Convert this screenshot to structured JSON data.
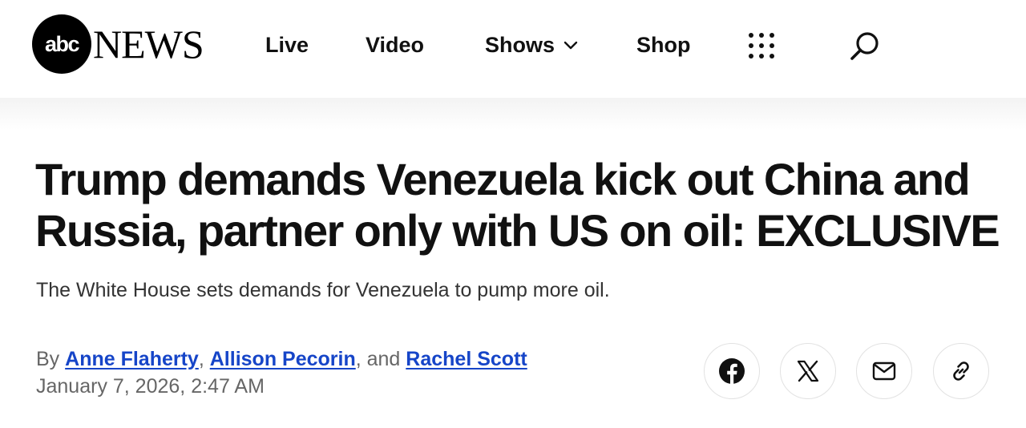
{
  "brand": {
    "logo_abc": "abc",
    "logo_news": "NEWS"
  },
  "nav": {
    "items": [
      {
        "label": "Live"
      },
      {
        "label": "Video"
      },
      {
        "label": "Shows"
      },
      {
        "label": "Shop"
      }
    ],
    "more_icon": "grid-dots-icon",
    "search_icon": "search-icon"
  },
  "article": {
    "headline": "Trump demands Venezuela kick out China and Russia, partner only with US on oil: EXCLUSIVE",
    "subheadline": "The White House sets demands for Venezuela to pump more oil.",
    "byline_prefix": "By",
    "authors": [
      {
        "name": "Anne Flaherty"
      },
      {
        "name": "Allison Pecorin"
      },
      {
        "name": "Rachel Scott"
      }
    ],
    "author_sep": ",",
    "author_and": ", and",
    "date": "January 7, 2026, 2:47 AM"
  },
  "share": {
    "buttons": [
      {
        "icon": "facebook-icon"
      },
      {
        "icon": "x-icon"
      },
      {
        "icon": "mail-icon"
      },
      {
        "icon": "link-icon"
      }
    ]
  },
  "colors": {
    "link": "#1645c8",
    "text": "#111111",
    "muted": "#666666"
  }
}
